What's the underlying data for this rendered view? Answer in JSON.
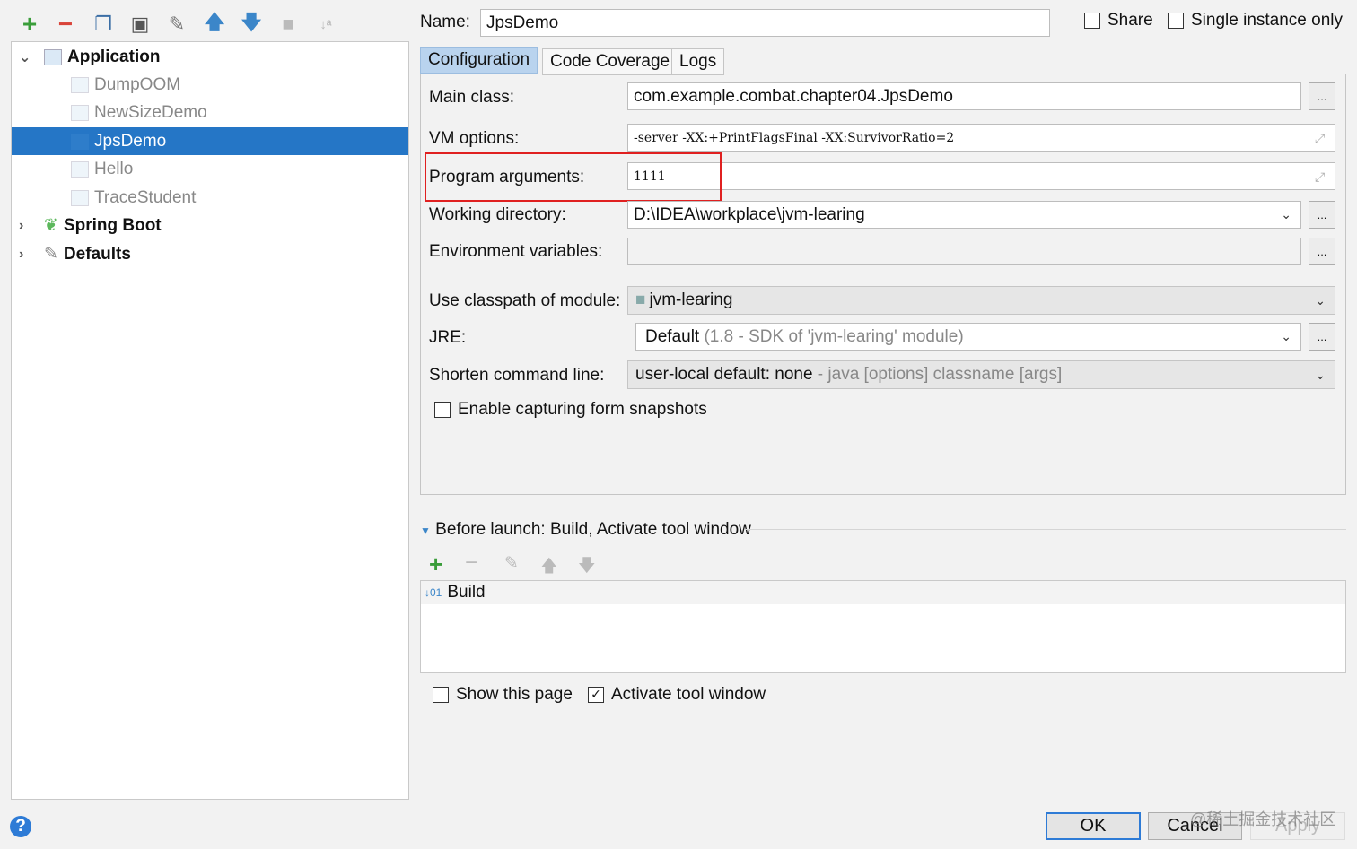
{
  "toolbar": {
    "icons": [
      "add-icon",
      "remove-icon",
      "copy-icon",
      "save-icon",
      "edit-defaults-icon",
      "move-up-icon",
      "move-down-icon",
      "folder-icon",
      "sort-icon"
    ]
  },
  "tree": {
    "groups": [
      {
        "label": "Application",
        "children": [
          "DumpOOM",
          "NewSizeDemo",
          "JpsDemo",
          "Hello",
          "TraceStudent"
        ],
        "selected": "JpsDemo"
      },
      {
        "label": "Spring Boot"
      },
      {
        "label": "Defaults"
      }
    ]
  },
  "header": {
    "name_label": "Name:",
    "name_value": "JpsDemo",
    "share_label": "Share",
    "single_instance_label": "Single instance only"
  },
  "tabs": [
    "Configuration",
    "Code Coverage",
    "Logs"
  ],
  "form": {
    "main_class_label": "Main class:",
    "main_class": "com.example.combat.chapter04.JpsDemo",
    "vm_options_label": "VM options:",
    "vm_options": "-server -XX:+PrintFlagsFinal -XX:SurvivorRatio=2",
    "program_args_label": "Program arguments:",
    "program_args": "1111",
    "working_dir_label": "Working directory:",
    "working_dir": "D:\\IDEA\\workplace\\jvm-learing",
    "env_label": "Environment variables:",
    "env": "",
    "classpath_label": "Use classpath of module:",
    "classpath": "jvm-learing",
    "jre_label": "JRE:",
    "jre": "Default",
    "jre_hint": "(1.8 - SDK of 'jvm-learing' module)",
    "shorten_label": "Shorten command line:",
    "shorten": "user-local default: none",
    "shorten_hint": " - java [options] classname [args]",
    "snapshots_label": "Enable capturing form snapshots",
    "ellipsis": "..."
  },
  "before_launch": {
    "title": "Before launch: Build, Activate tool window",
    "items": [
      "Build"
    ],
    "show_page_label": "Show this page",
    "activate_label": "Activate tool window",
    "activate_checked": true
  },
  "buttons": {
    "ok": "OK",
    "cancel": "Cancel",
    "apply": "Apply",
    "help": "?"
  },
  "watermark": "@稀土掘金技术社区",
  "colors": {
    "selection": "#2576c6",
    "highlight_box": "#e02020",
    "add": "#3a9d3a",
    "remove": "#d9443a",
    "arrow": "#3b86c9"
  }
}
